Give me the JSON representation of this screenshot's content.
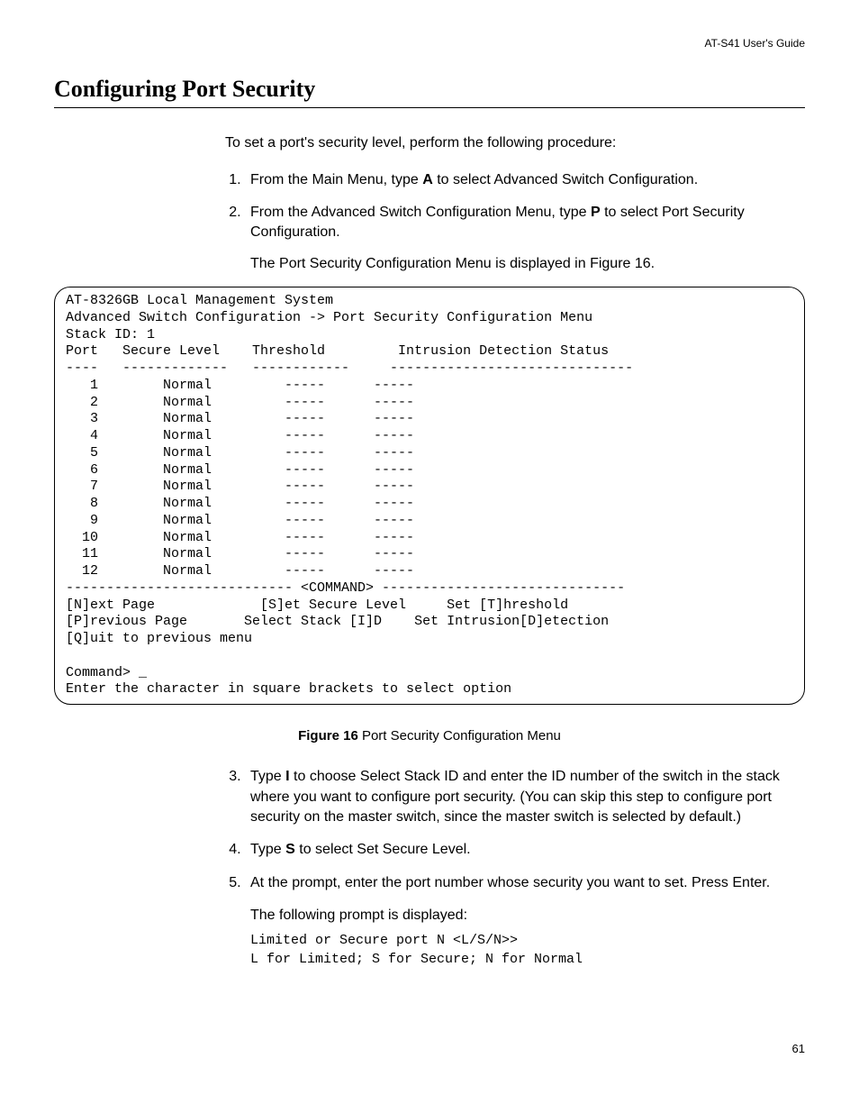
{
  "header": {
    "guide_title": "AT-S41 User's Guide"
  },
  "section": {
    "title": "Configuring Port Security",
    "intro": "To set a port's security level, perform the following procedure:",
    "step1_pre": "From the Main Menu, type ",
    "step1_key": "A",
    "step1_post": " to select Advanced Switch Configuration.",
    "step2_pre": "From the Advanced Switch Configuration Menu, type ",
    "step2_key": "P",
    "step2_post": " to select Port Security Configuration.",
    "figure_note": "The Port Security Configuration Menu is displayed in Figure 16."
  },
  "terminal": {
    "line01": "AT-8326GB Local Management System",
    "line02": "Advanced Switch Configuration -> Port Security Configuration Menu",
    "line03": "Stack ID: 1",
    "line04": "Port   Secure Level    Threshold         Intrusion Detection Status",
    "line05": "----   -------------   ------------     ------------------------------",
    "row01": "   1        Normal         -----      -----",
    "row02": "   2        Normal         -----      -----",
    "row03": "   3        Normal         -----      -----",
    "row04": "   4        Normal         -----      -----",
    "row05": "   5        Normal         -----      -----",
    "row06": "   6        Normal         -----      -----",
    "row07": "   7        Normal         -----      -----",
    "row08": "   8        Normal         -----      -----",
    "row09": "   9        Normal         -----      -----",
    "row10": "  10        Normal         -----      -----",
    "row11": "  11        Normal         -----      -----",
    "row12": "  12        Normal         -----      -----",
    "cmd_div": "---------------------------- <COMMAND> ------------------------------",
    "cmd1": "[N]ext Page             [S]et Secure Level     Set [T]hreshold",
    "cmd2": "[P]revious Page       Select Stack [I]D    Set Intrusion[D]etection",
    "cmd3": "[Q]uit to previous menu",
    "blank": "",
    "prompt": "Command> _",
    "hint": "Enter the character in square brackets to select option"
  },
  "figure": {
    "label": "Figure 16",
    "caption": "  Port Security Configuration Menu"
  },
  "steps_after": {
    "step3_pre": "Type ",
    "step3_key": "I",
    "step3_post": " to choose Select Stack ID and enter the ID number of the switch in the stack where you want to configure port security. (You can skip this step to configure port security on the master switch, since the master switch is selected by default.)",
    "step4_pre": "Type ",
    "step4_key": "S",
    "step4_post": " to select Set Secure Level.",
    "step5": "At the prompt, enter the port number whose security you want to set. Press Enter.",
    "prompt_intro": "The following prompt is displayed:",
    "prompt_line1": "Limited or Secure port N <L/S/N>>",
    "prompt_line2": "L for Limited; S for Secure; N for Normal"
  },
  "page_number": "61"
}
